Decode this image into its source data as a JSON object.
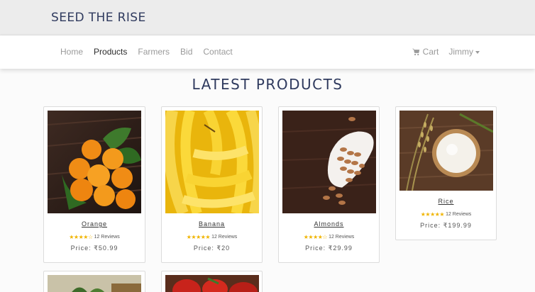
{
  "brand": "SEED THE RISE",
  "nav": {
    "items": [
      "Home",
      "Products",
      "Farmers",
      "Bid",
      "Contact"
    ],
    "active": "Products",
    "cart_label": "Cart",
    "user_label": "Jimmy"
  },
  "heading": "LATEST PRODUCTS",
  "products": [
    {
      "name": "Orange",
      "rating": 3.5,
      "stars": "★★★★☆",
      "reviews": "12 Reviews",
      "price": "Price: ₹50.99"
    },
    {
      "name": "Banana",
      "rating": 4.5,
      "stars": "★★★★★",
      "reviews": "12 Reviews",
      "price": "Price: ₹20"
    },
    {
      "name": "Almonds",
      "rating": 4,
      "stars": "★★★★☆",
      "reviews": "12 Reviews",
      "price": "Price: ₹29.99"
    },
    {
      "name": "Rice",
      "rating": 5,
      "stars": "★★★★★",
      "reviews": "12 Reviews",
      "price": "Price: ₹199.99"
    }
  ]
}
